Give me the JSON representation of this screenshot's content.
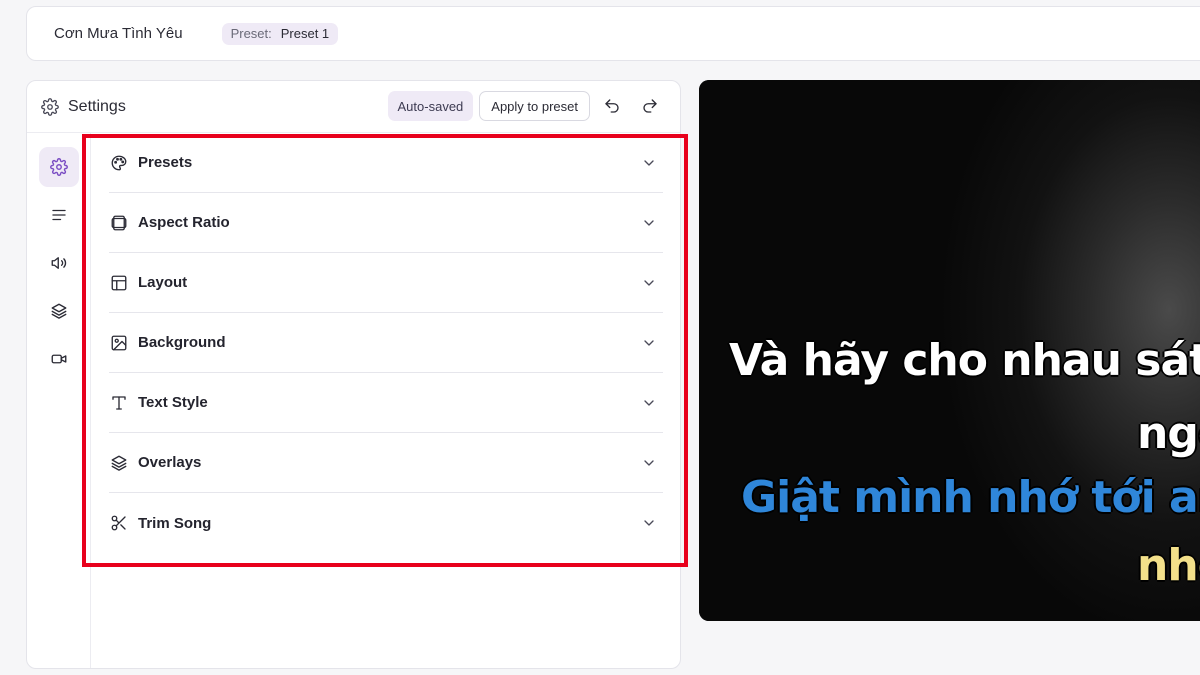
{
  "topbar": {
    "song_title": "Cơn Mưa Tình Yêu",
    "preset_label": "Preset:",
    "preset_value": "Preset 1"
  },
  "settings": {
    "title": "Settings",
    "autosaved_label": "Auto-saved",
    "apply_label": "Apply to preset"
  },
  "rail": {
    "items": [
      {
        "icon": "gear-icon",
        "active": true
      },
      {
        "icon": "lines-icon",
        "active": false
      },
      {
        "icon": "speaker-icon",
        "active": false
      },
      {
        "icon": "layers-icon",
        "active": false
      },
      {
        "icon": "video-camera-icon",
        "active": false
      }
    ]
  },
  "sections": [
    {
      "label": "Presets",
      "icon": "palette-icon"
    },
    {
      "label": "Aspect Ratio",
      "icon": "aspect-ratio-icon"
    },
    {
      "label": "Layout",
      "icon": "layout-icon"
    },
    {
      "label": "Background",
      "icon": "image-icon"
    },
    {
      "label": "Text Style",
      "icon": "text-icon"
    },
    {
      "label": "Overlays",
      "icon": "layers-icon"
    },
    {
      "label": "Trim Song",
      "icon": "scissors-icon"
    }
  ],
  "preview": {
    "line1": "Và hãy cho nhau sát",
    "line2": "ngơ",
    "line3": "Giật mình nhớ tới an",
    "line4": "nhớ"
  },
  "colors": {
    "accent": "#7c4fc4",
    "highlight": "#e8001c",
    "lyric_blue": "#2f86d9",
    "lyric_yellow": "#f3e08a"
  }
}
